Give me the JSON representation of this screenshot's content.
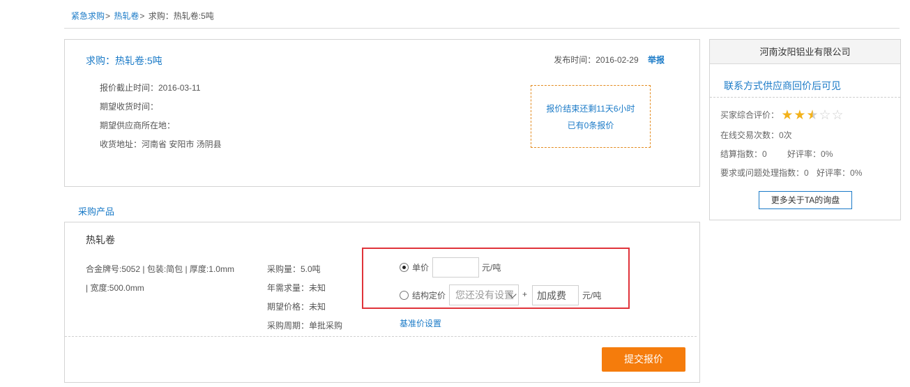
{
  "breadcrumb": {
    "item1": "紧急求购",
    "item2": "热轧卷",
    "current": "求购：热轧卷:5吨",
    "sep": ">"
  },
  "request": {
    "title": "求购：热轧卷:5吨",
    "publish_label": "发布时间：2016-02-29",
    "report_label": "举报",
    "deadline": "报价截止时间：2016-03-11",
    "expected_receipt": "期望收货时间：",
    "supplier_location": "期望供应商所在地：",
    "delivery_address": "收货地址：河南省 安阳市 汤阴县",
    "countdown_line1": "报价结束还剩11天6小时",
    "countdown_line2": "已有0条报价"
  },
  "sidebar": {
    "company": "河南汝阳铝业有限公司",
    "contact_note": "联系方式供应商回价后可见",
    "rating_label": "买家综合评价：",
    "rating": 2.5,
    "rating_max": 5,
    "trade_count": "在线交易次数：0次",
    "settle_index": "结算指数：0",
    "settle_good_rate": "好评率：0%",
    "issue_index": "要求或问题处理指数：0",
    "issue_good_rate": "好评率：0%",
    "more_button": "更多关于TA的询盘"
  },
  "section_label": "采购产品",
  "product": {
    "name": "热轧卷",
    "spec_line1": "合金牌号:5052 | 包装:简包 | 厚度:1.0mm",
    "spec_line2": "| 宽度:500.0mm",
    "qty": "采购量：5.0吨",
    "annual": "年需求量：未知",
    "expected_price": "期望价格：未知",
    "cycle": "采购周期：单批采购"
  },
  "pricing": {
    "unit_price_label": "单价",
    "unit_price_value": "",
    "unit": "元/吨",
    "structured_label": "结构定价",
    "structured_select": "您还没有设置",
    "plus": "+",
    "fee_placeholder": "加成费",
    "unit2": "元/吨",
    "base_price_link": "基准价设置"
  },
  "submit_label": "提交报价",
  "colors": {
    "link": "#1a7ac7",
    "accent_orange": "#f57c0c",
    "highlight_red": "#e0333a",
    "star": "#f3b21b"
  }
}
